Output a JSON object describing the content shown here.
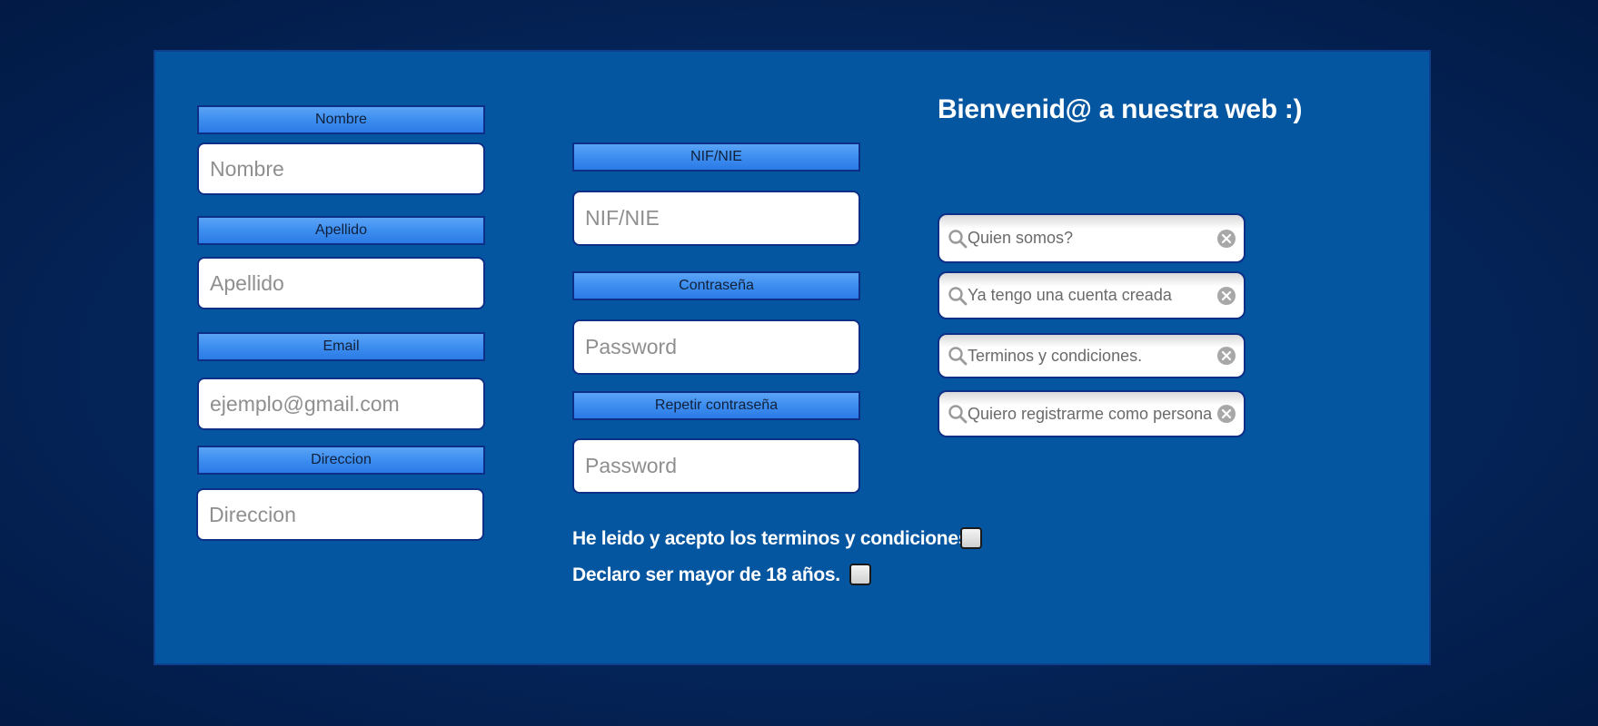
{
  "form": {
    "left_column": [
      {
        "label": "Nombre",
        "placeholder": "Nombre"
      },
      {
        "label": "Apellido",
        "placeholder": "Apellido"
      },
      {
        "label": "Email",
        "placeholder": "ejemplo@gmail.com"
      },
      {
        "label": "Direccion",
        "placeholder": "Direccion"
      }
    ],
    "middle_column": [
      {
        "label": "NIF/NIE",
        "placeholder": "NIF/NIE"
      },
      {
        "label": "Contraseña",
        "placeholder": "Password"
      },
      {
        "label": "Repetir contraseña",
        "placeholder": "Password"
      }
    ],
    "checkboxes": [
      {
        "label": "He leido y acepto los terminos y condiciones",
        "checked": false
      },
      {
        "label": "Declaro ser mayor de 18 años.",
        "checked": false
      }
    ]
  },
  "welcome": {
    "title": "Bienvenid@ a nuestra web  :)"
  },
  "search_links": [
    {
      "placeholder": "Quien somos?"
    },
    {
      "placeholder": "Ya tengo una cuenta creada"
    },
    {
      "placeholder": "Terminos y condiciones."
    },
    {
      "placeholder": "Quiero registrarme como personal."
    }
  ],
  "icons": {
    "search": "magnifier-icon",
    "clear": "clear-circle-icon"
  },
  "colors": {
    "page_background": "#05275e",
    "panel": "#0556a0",
    "label_gradient_top": "#5aa4f5",
    "label_gradient_bottom": "#2b7ae6",
    "border": "#0e2f86",
    "text_white": "#ffffff"
  }
}
